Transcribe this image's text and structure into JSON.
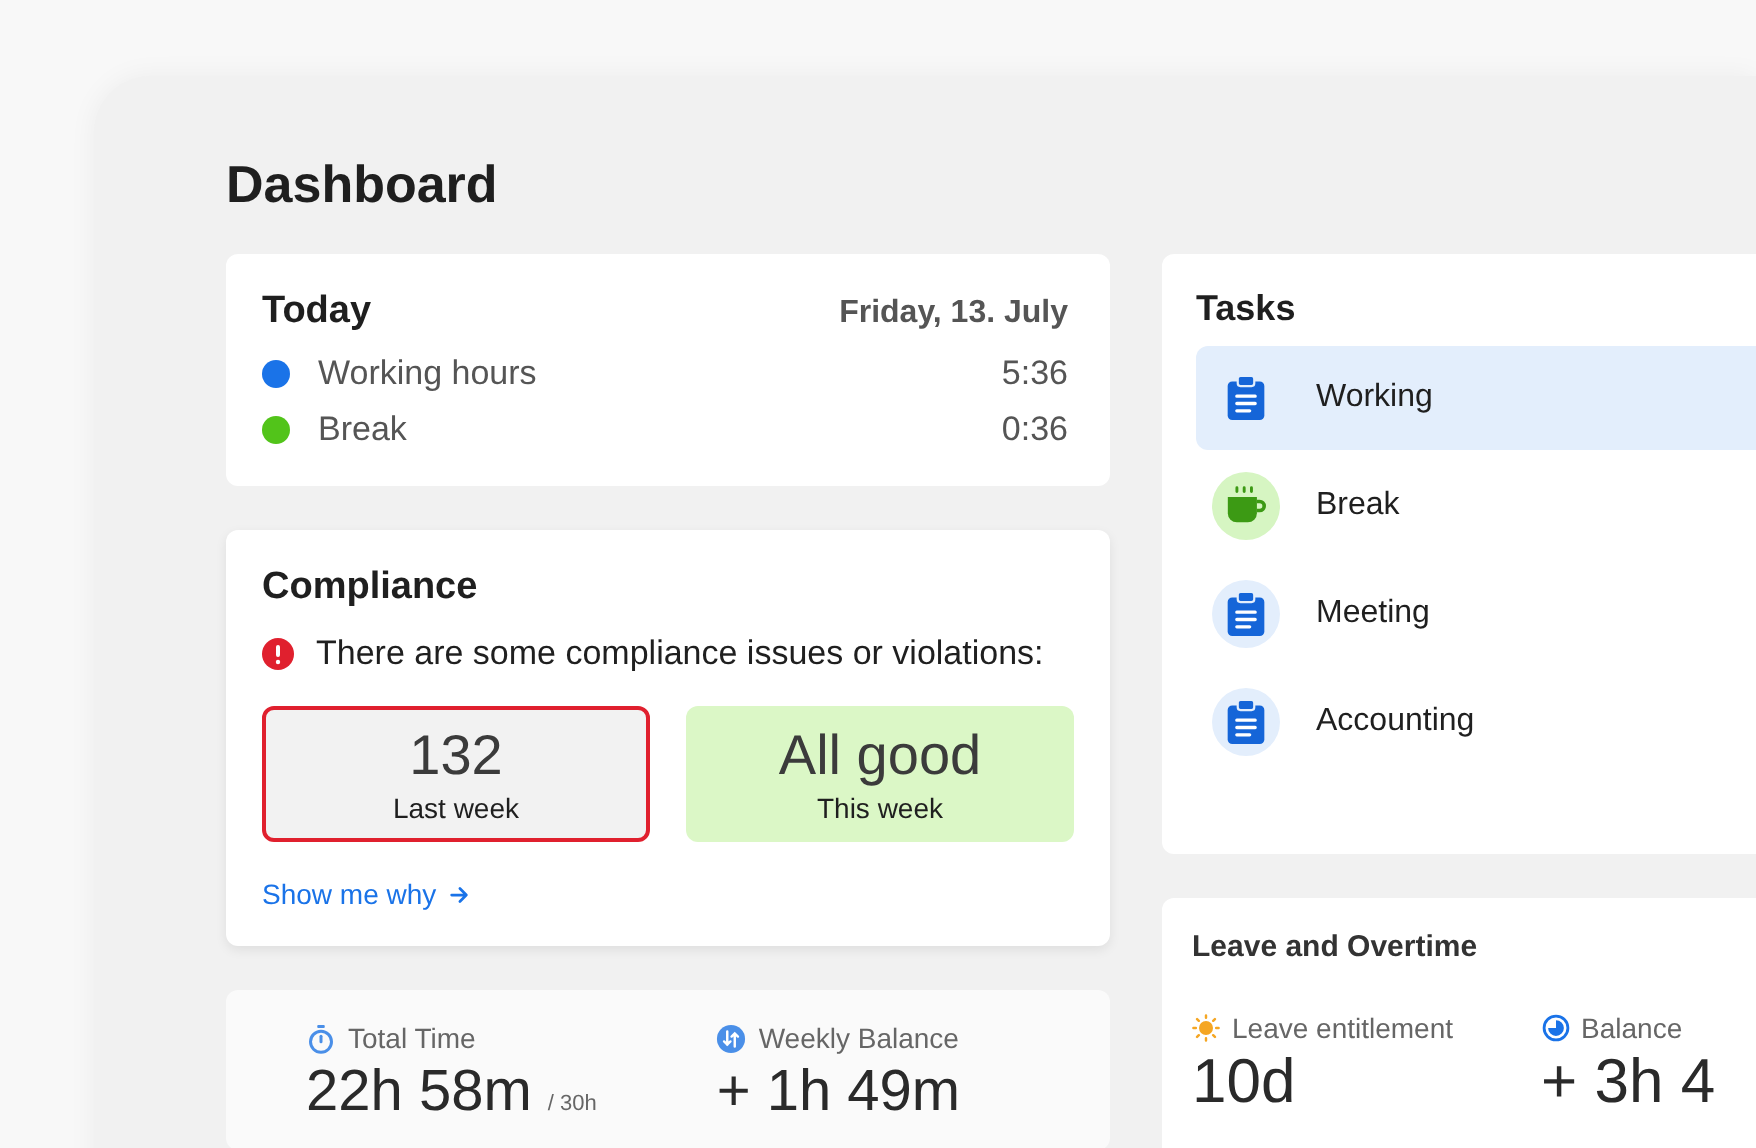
{
  "page_title": "Dashboard",
  "today": {
    "title": "Today",
    "date": "Friday, 13. July",
    "rows": [
      {
        "label": "Working hours",
        "value": "5:36",
        "color": "#1a73e8"
      },
      {
        "label": "Break",
        "value": "0:36",
        "color": "#52c41a"
      }
    ]
  },
  "compliance": {
    "title": "Compliance",
    "message": "There are some compliance issues or violations:",
    "tiles": [
      {
        "kind": "violation",
        "value": "132",
        "label": "Last week"
      },
      {
        "kind": "ok",
        "value": "All good",
        "label": "This week"
      }
    ],
    "link": "Show me why"
  },
  "summary": [
    {
      "kind": "stopwatch",
      "label": "Total Time",
      "value": "22h 58m",
      "suffix": "/ 30h"
    },
    {
      "kind": "balance",
      "label": "Weekly Balance",
      "value": "+ 1h 49m"
    }
  ],
  "tasks": {
    "title": "Tasks",
    "items": [
      {
        "kind": "clipboard",
        "label": "Working",
        "selected": true
      },
      {
        "kind": "coffee",
        "label": "Break",
        "selected": false
      },
      {
        "kind": "clipboard",
        "label": "Meeting",
        "selected": false
      },
      {
        "kind": "clipboard",
        "label": "Accounting",
        "selected": false
      }
    ]
  },
  "leave": {
    "title": "Leave and Overtime",
    "stats": [
      {
        "kind": "sun",
        "label": "Leave entitlement",
        "value": "10d"
      },
      {
        "kind": "pie",
        "label": "Balance",
        "value": "+ 3h 4"
      }
    ]
  }
}
